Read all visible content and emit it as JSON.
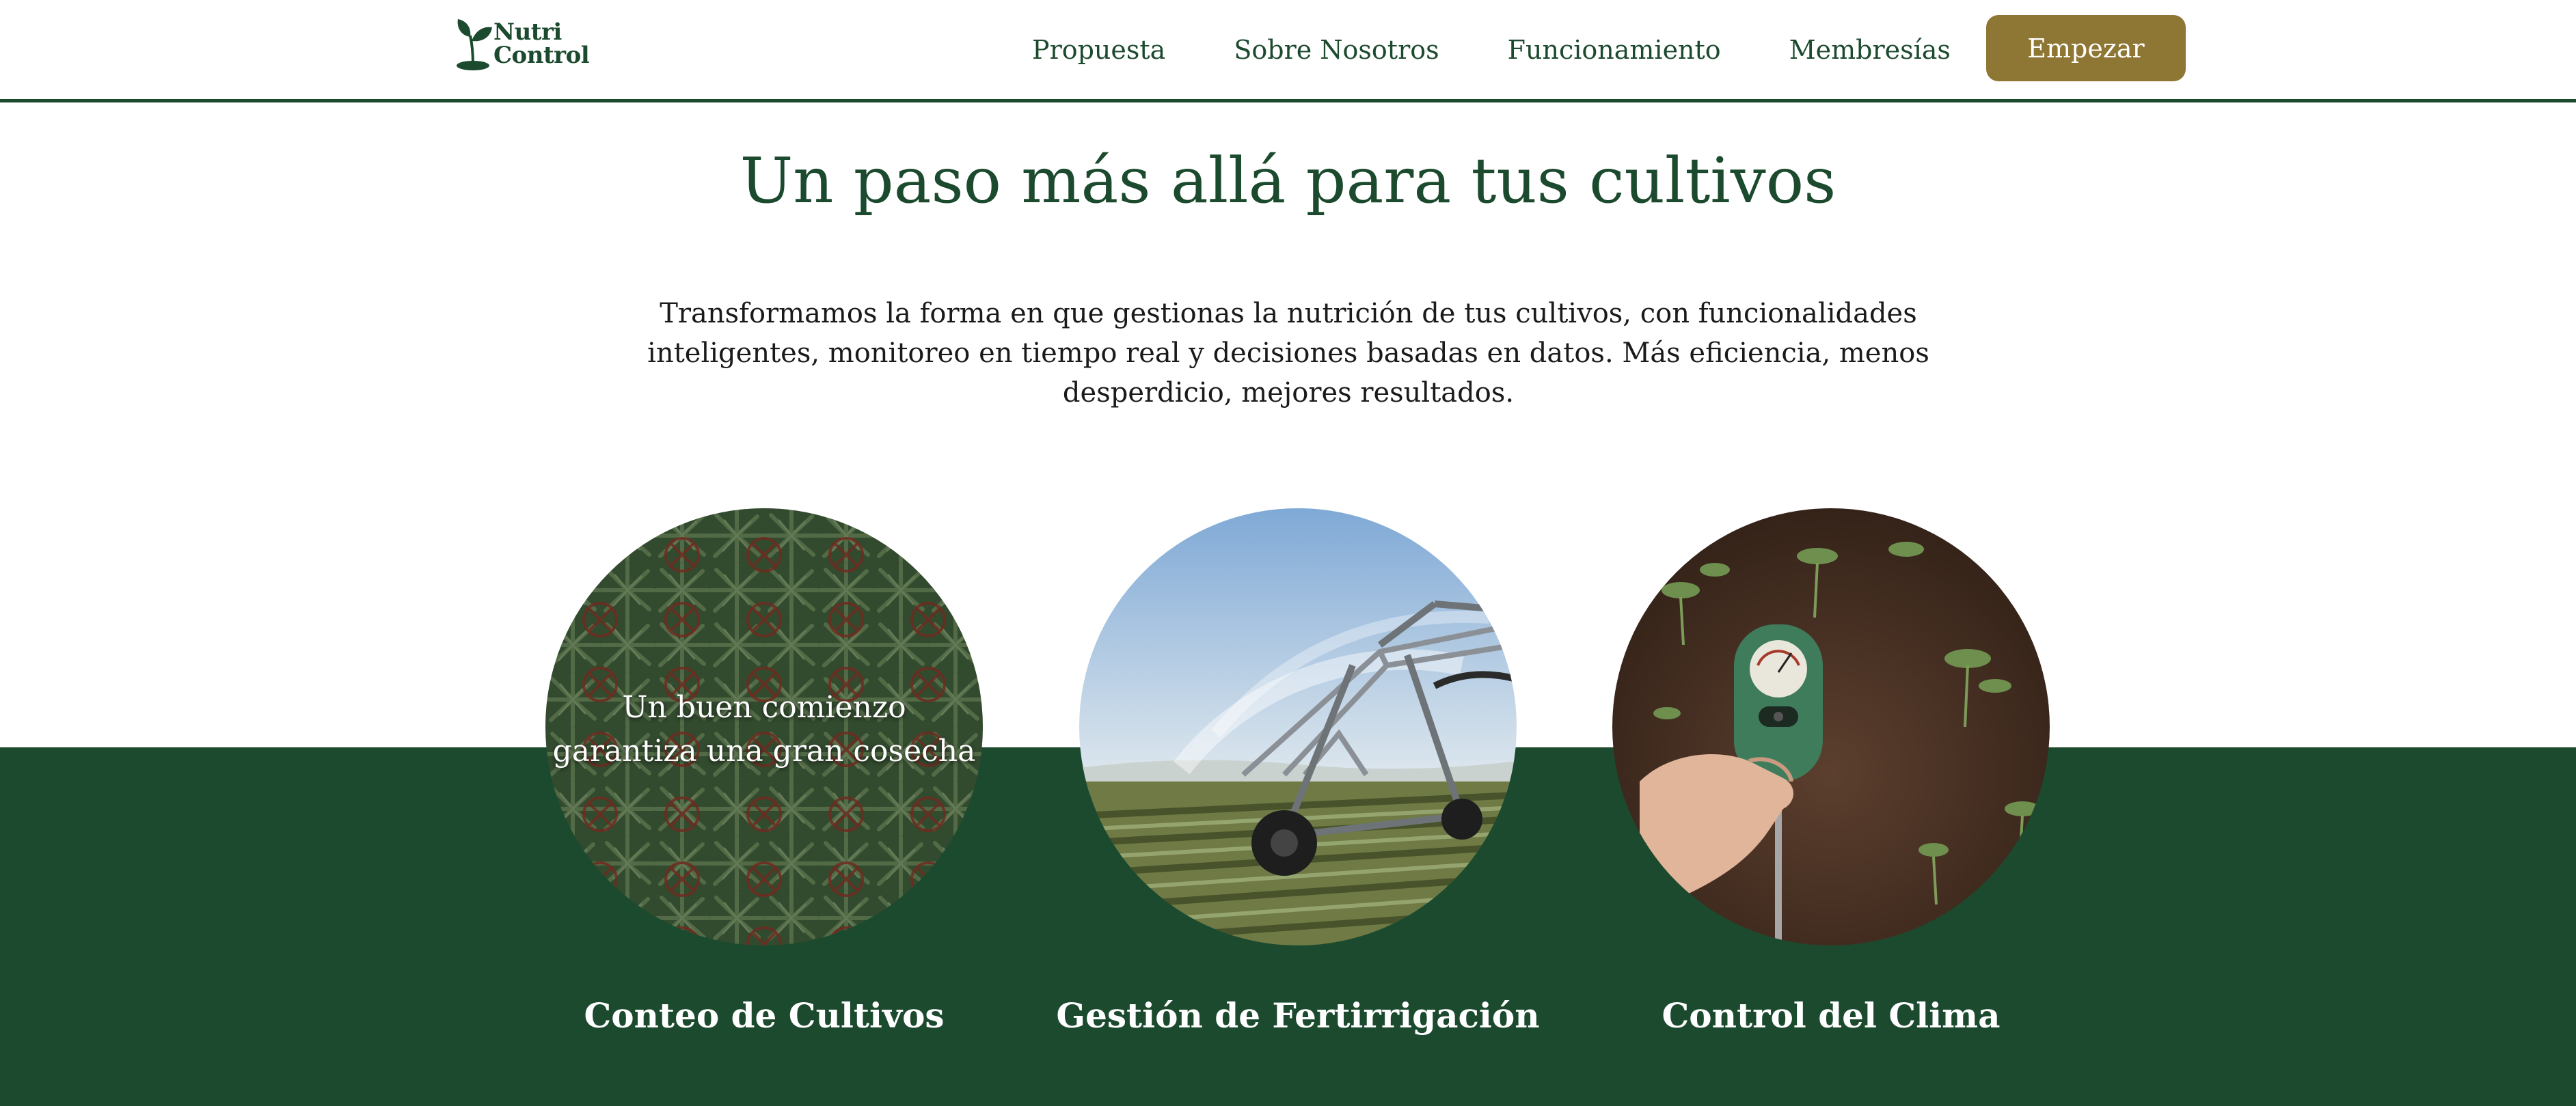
{
  "brand": {
    "name_line1": "Nutri",
    "name_line2": "Control",
    "primary_color": "#1c4a2e",
    "accent_color": "#8e7634"
  },
  "nav": {
    "items": [
      {
        "label": "Propuesta"
      },
      {
        "label": "Sobre Nosotros"
      },
      {
        "label": "Funcionamiento"
      },
      {
        "label": "Membresías"
      }
    ],
    "cta_label": "Empezar"
  },
  "hero": {
    "title": "Un paso más allá para tus cultivos",
    "description": "Transformamos la forma en que gestionas la nutrición de tus cultivos, con funcionalidades inteligentes, monitoreo en tiempo real y decisiones basadas en datos. Más eficiencia, menos desperdicio, mejores resultados."
  },
  "features": [
    {
      "title": "Conteo de Cultivos",
      "overlay_text": "Un buen comienzo garantiza una gran cosecha",
      "image_icon": "crop-count-photo"
    },
    {
      "title": "Gestión de Fertirrigación",
      "image_icon": "irrigation-photo"
    },
    {
      "title": "Control del Clima",
      "image_icon": "soil-meter-photo"
    }
  ]
}
